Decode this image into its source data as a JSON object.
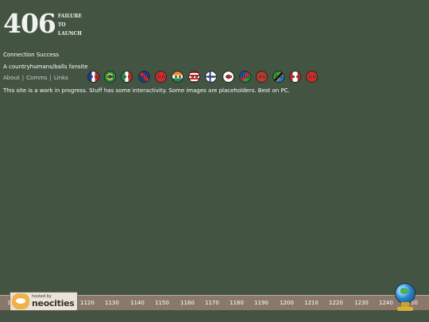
{
  "logo": {
    "code": "406",
    "words": [
      "FAILURE",
      "TO",
      "LAUNCH"
    ]
  },
  "status_text": "Connection Success",
  "tagline": "A countryhumans/balls fansite",
  "nav": {
    "items": [
      "About",
      "Comms",
      "Links"
    ],
    "separator": "|"
  },
  "countryballs": [
    {
      "name": "france-ball-icon"
    },
    {
      "name": "brazil-ball-icon"
    },
    {
      "name": "mexico-ball-icon"
    },
    {
      "name": "uk-ball-icon"
    },
    {
      "name": "china-ball-icon"
    },
    {
      "name": "india-ball-icon"
    },
    {
      "name": "usa-ball-icon"
    },
    {
      "name": "finland-ball-icon"
    },
    {
      "name": "japan-ball-icon"
    },
    {
      "name": "namibia-ball-icon"
    },
    {
      "name": "russia-ball-icon"
    },
    {
      "name": "tanzania-ball-icon"
    },
    {
      "name": "canada-ball-icon"
    },
    {
      "name": "turkey-ball-icon"
    }
  ],
  "notice": "This site is a work in progress. Stuff has some interactivity. Some images are placeholders. Best on PC.",
  "footer": {
    "ticks": [
      "11",
      "1120",
      "1130",
      "1140",
      "1150",
      "1160",
      "1170",
      "1180",
      "1190",
      "1200",
      "1210",
      "1220",
      "1230",
      "1240",
      "50"
    ],
    "hosted_by": "hosted by",
    "host_name": "neocities"
  },
  "colors": {
    "background": "#435443",
    "footer_bar": "#8a786b",
    "text": "#ffffff"
  }
}
